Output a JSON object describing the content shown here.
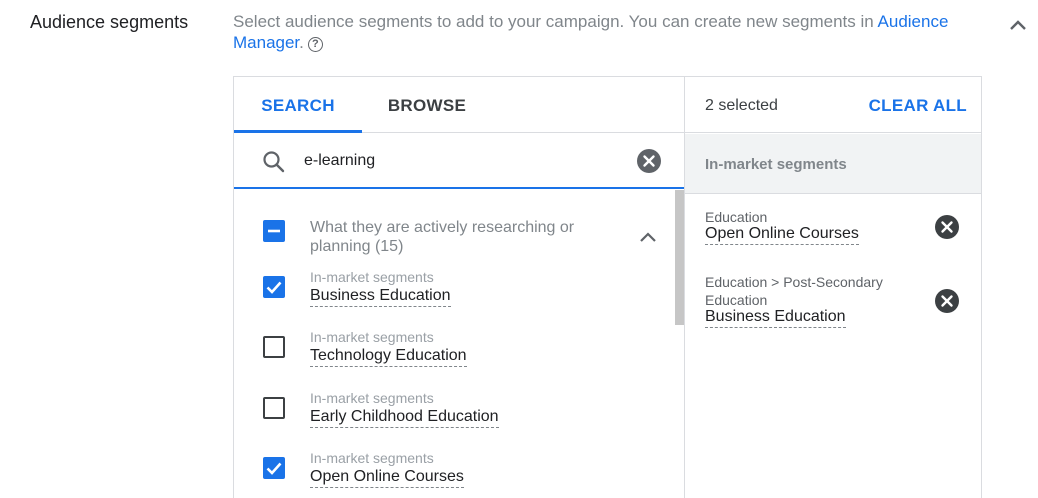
{
  "section": {
    "title": "Audience segments",
    "description": "Select audience segments to add to your campaign. You can create new segments in ",
    "link_text": "Audience Manager",
    "description_end": ".",
    "help_icon": "?"
  },
  "tabs": [
    {
      "label": "SEARCH",
      "active": true
    },
    {
      "label": "BROWSE",
      "active": false
    }
  ],
  "search": {
    "value": "e-learning",
    "placeholder": ""
  },
  "group": {
    "label": "What they are actively researching or planning (15)",
    "state": "indeterminate"
  },
  "items": [
    {
      "category": "In-market segments",
      "name": "Business Education",
      "checked": true
    },
    {
      "category": "In-market segments",
      "name": "Technology Education",
      "checked": false
    },
    {
      "category": "In-market segments",
      "name": "Early Childhood Education",
      "checked": false
    },
    {
      "category": "In-market segments",
      "name": "Open Online Courses",
      "checked": true
    }
  ],
  "selected": {
    "count_label": "2 selected",
    "clear_all_label": "CLEAR ALL",
    "group_label": "In-market segments",
    "items": [
      {
        "path": "Education",
        "name": "Open Online Courses"
      },
      {
        "path": "Education > Post-Secondary Education",
        "name": "Business Education"
      }
    ]
  },
  "colors": {
    "accent": "#1a73e8",
    "muted_text": "#80868b",
    "divider": "#dadce0",
    "icon_dark": "#5f6368"
  }
}
